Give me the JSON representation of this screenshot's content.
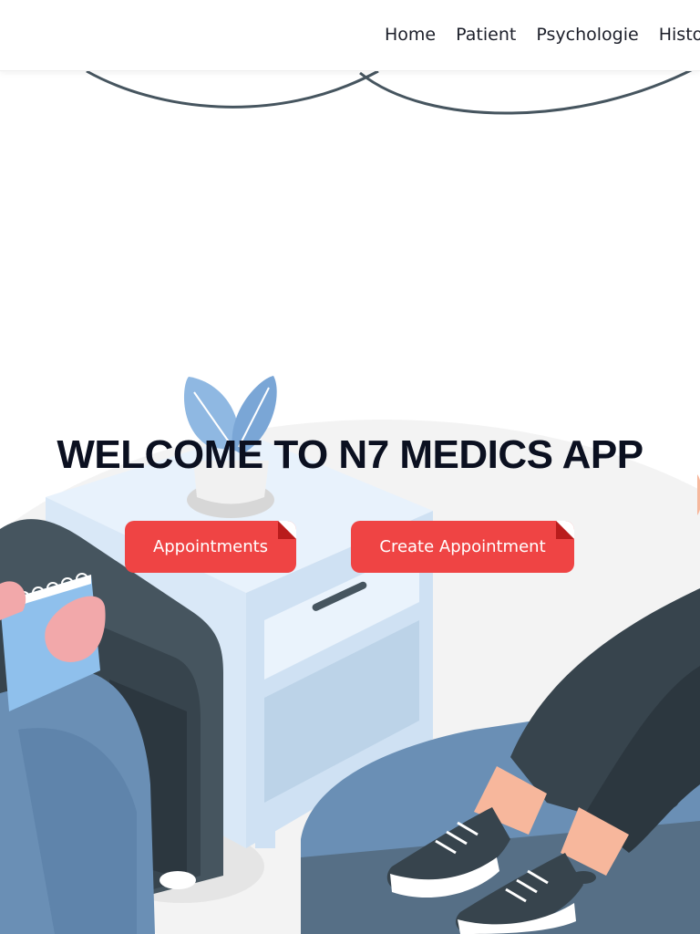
{
  "nav": {
    "items": [
      {
        "label": "Home"
      },
      {
        "label": "Patient"
      },
      {
        "label": "Psychologie"
      },
      {
        "label": "Histori"
      }
    ]
  },
  "hero": {
    "title": "WELCOME TO N7 MEDICS APP",
    "buttons": {
      "appointments": "Appointments",
      "create": "Create Appointment"
    }
  },
  "colors": {
    "accent": "#ef4444",
    "text": "#0b1020"
  },
  "icons": [
    "hanging-wire-decoration",
    "therapy-session-illustration",
    "plant-icon",
    "notepad-icon"
  ]
}
